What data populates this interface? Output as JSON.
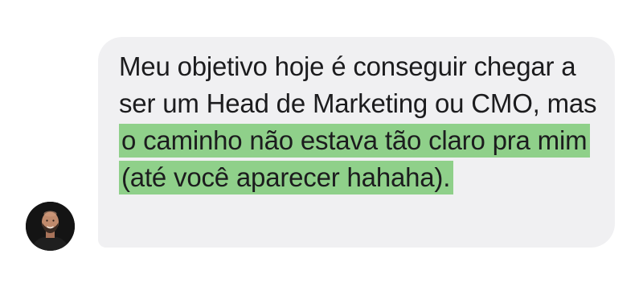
{
  "message": {
    "text_before_highlight": "Meu objetivo hoje é conseguir chegar a ser um Head de Marketing ou CMO, mas ",
    "highlighted_text": "o caminho não estava tão claro pra mim (até você aparecer hahaha).",
    "highlight_color": "#8fd08a",
    "bubble_color": "#f0f0f2",
    "text_color": "#1c1c1e"
  },
  "sender": {
    "avatar_icon": "person-avatar-icon"
  }
}
